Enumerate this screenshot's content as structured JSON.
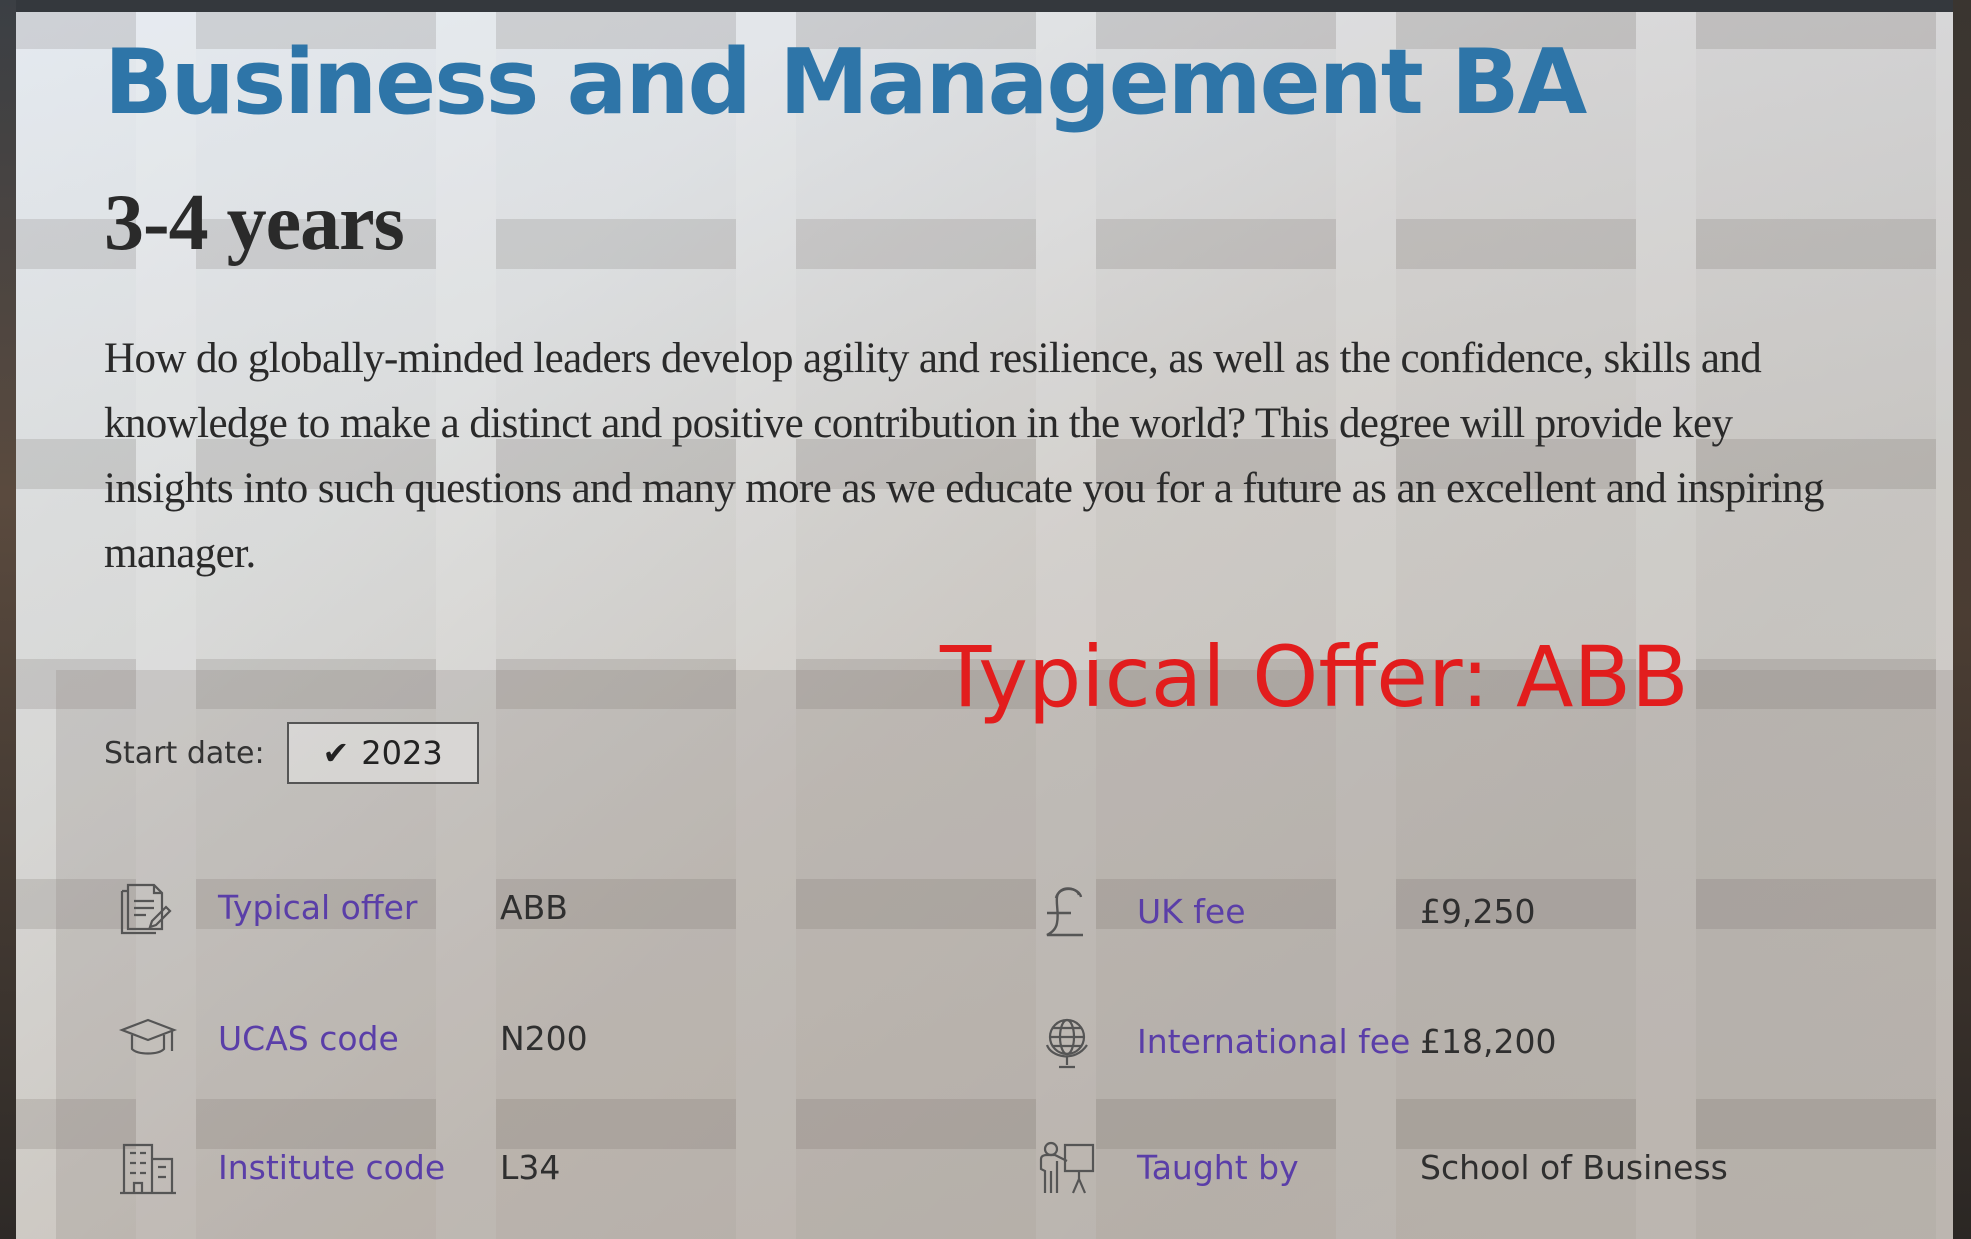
{
  "course": {
    "title": "Business and Management BA",
    "duration": "3-4 years",
    "description": "How do globally-minded leaders develop agility and resilience, as well as the confidence, skills and knowledge to make a distinct and positive contribution in the world? This degree will provide key insights into such questions and many more as we educate you for a future as an excellent and inspiring manager."
  },
  "overlay": {
    "typical_offer_text": "Typical Offer: ABB",
    "color": "#e21d1d"
  },
  "start_date": {
    "label": "Start date:",
    "selected": "2023",
    "check_icon": "checkmark-icon"
  },
  "facts": {
    "typical_offer": {
      "label": "Typical offer",
      "value": "ABB",
      "icon": "document-edit-icon"
    },
    "ucas_code": {
      "label": "UCAS code",
      "value": "N200",
      "icon": "graduation-cap-icon"
    },
    "institute_code": {
      "label": "Institute code",
      "value": "L34",
      "icon": "building-icon"
    },
    "uk_fee": {
      "label": "UK fee",
      "value": "£9,250",
      "icon": "pound-icon"
    },
    "international_fee": {
      "label": "International fee",
      "value": "£18,200",
      "icon": "globe-icon"
    },
    "taught_by": {
      "label": "Taught by",
      "value": "School of Business",
      "icon": "teacher-icon"
    }
  },
  "colors": {
    "title": "#2e75a8",
    "fact_label": "#5a3ea8",
    "text": "#2a2a2a"
  }
}
